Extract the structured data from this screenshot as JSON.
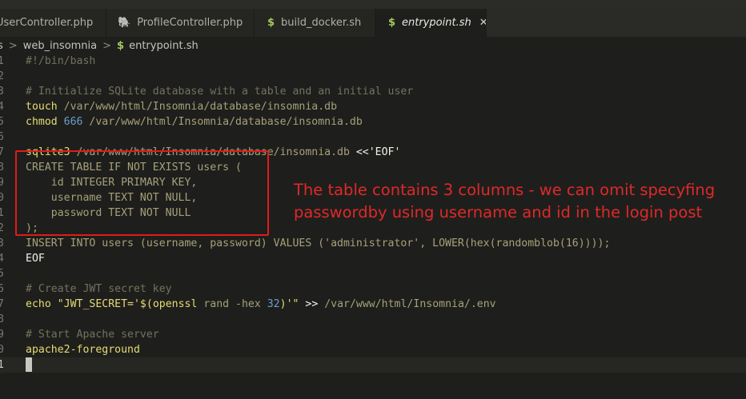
{
  "tabs": [
    {
      "label": "UserController.php",
      "icon": "php-icon",
      "active": false
    },
    {
      "label": "ProfileController.php",
      "icon": "php-icon",
      "active": false
    },
    {
      "label": "build_docker.sh",
      "icon": "shell-icon",
      "active": false
    },
    {
      "label": "entrypoint.sh",
      "icon": "shell-icon",
      "active": true
    }
  ],
  "breadcrumb": {
    "prefix": "s",
    "folder": "web_insomnia",
    "file": "entrypoint.sh",
    "shell_icon_glyph": "$"
  },
  "icons": {
    "php_glyph": "🐘",
    "shell_glyph": "$",
    "close_glyph": "✕",
    "chevron_glyph": ">"
  },
  "editor": {
    "line_numbers": [
      "1",
      "2",
      "3",
      "4",
      "5",
      "6",
      "7",
      "8",
      "9",
      "0",
      "1",
      "2",
      "3",
      "4",
      "5",
      "6",
      "7",
      "8",
      "9",
      "0",
      "1"
    ],
    "lines": {
      "l1": "#!/bin/bash",
      "l3": "# Initialize SQLite database with a table and an initial user",
      "l4_cmd": "touch",
      "l4_path": " /var/www/html/Insomnia/database/insomnia.db",
      "l5_cmd": "chmod",
      "l5_num": " 666",
      "l5_path": " /var/www/html/Insomnia/database/insomnia.db",
      "l7_cmd": "sqlite3",
      "l7_path": " /var/www/html/Insomnia/database/insomnia.db",
      "l7_heredoc": " <<'EOF'",
      "l8": "CREATE TABLE IF NOT EXISTS users (",
      "l9": "    id INTEGER PRIMARY KEY,",
      "l10": "    username TEXT NOT NULL,",
      "l11": "    password TEXT NOT NULL",
      "l12": ");",
      "l13": "INSERT INTO users (username, password) VALUES ('administrator', LOWER(hex(randomblob(16))));",
      "l14": "EOF",
      "l16": "# Create JWT secret key",
      "l17_cmd": "echo",
      "l17_str1": " \"JWT_SECRET='$(",
      "l17_sub": "openssl",
      "l17_str2": " rand -hex ",
      "l17_num": "32",
      "l17_str3": ")'\"",
      "l17_op": " >>",
      "l17_path": " /var/www/html/Insomnia/.env",
      "l19": "# Start Apache server",
      "l20": "apache2-foreground"
    }
  },
  "annotation": {
    "line1": "The table contains 3 columns - we can omit specyfing",
    "line2": "passwordby using username and id in the login post"
  },
  "colors": {
    "background": "#1e1f1c",
    "comment": "#75715e",
    "keyword": "#e6db74",
    "number": "#6c9ecc",
    "annotation_red": "#e01b1b"
  }
}
